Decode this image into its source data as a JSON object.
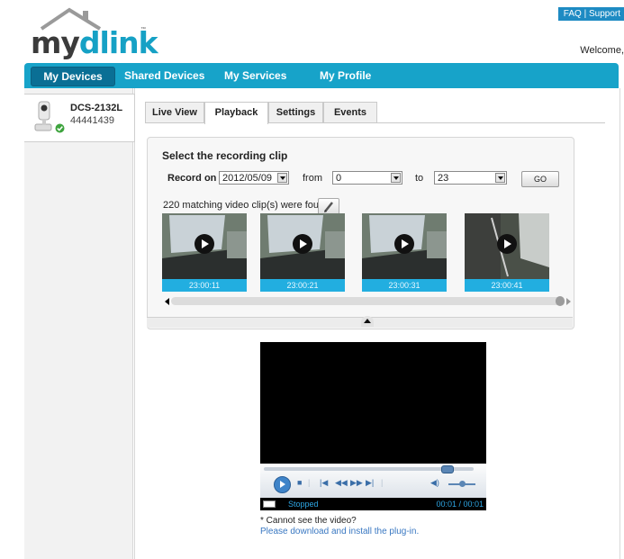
{
  "header": {
    "logo_my": "my",
    "logo_dlink": "dlink",
    "logo_tm": "™",
    "faq_label": "FAQ",
    "faq_sep": "|",
    "support_label": "Support",
    "welcome_text": "Welcome,"
  },
  "nav": {
    "items": [
      {
        "label": "My Devices"
      },
      {
        "label": "Shared Devices"
      },
      {
        "label": "My Services"
      },
      {
        "label": "My Profile"
      }
    ],
    "active": "My Devices",
    "accent": "#17a3c9"
  },
  "device": {
    "name": "DCS-2132L",
    "id": "44441439",
    "status": "online"
  },
  "tabs": {
    "items": [
      {
        "label": "Live View"
      },
      {
        "label": "Playback"
      },
      {
        "label": "Settings"
      },
      {
        "label": "Events"
      }
    ],
    "active": "Playback"
  },
  "clip_select": {
    "title": "Select the recording clip",
    "record_on_label": "Record on",
    "date_value": "2012/05/09",
    "from_label": "from",
    "from_value": "0",
    "to_label": "to",
    "to_value": "23",
    "go_label": "GO",
    "found_text": "220  matching video clip(s) were found."
  },
  "clips": [
    {
      "time": "23:00:11"
    },
    {
      "time": "23:00:21"
    },
    {
      "time": "23:00:31"
    },
    {
      "time": "23:00:41"
    }
  ],
  "player": {
    "status_text": "Stopped",
    "time_text": "00:01 / 00:01",
    "seek_fraction": 0.88,
    "volume_fraction": 0.5
  },
  "plugin": {
    "cant_see": "* Cannot see the video?",
    "install_link": "Please download and install the plug-in."
  }
}
